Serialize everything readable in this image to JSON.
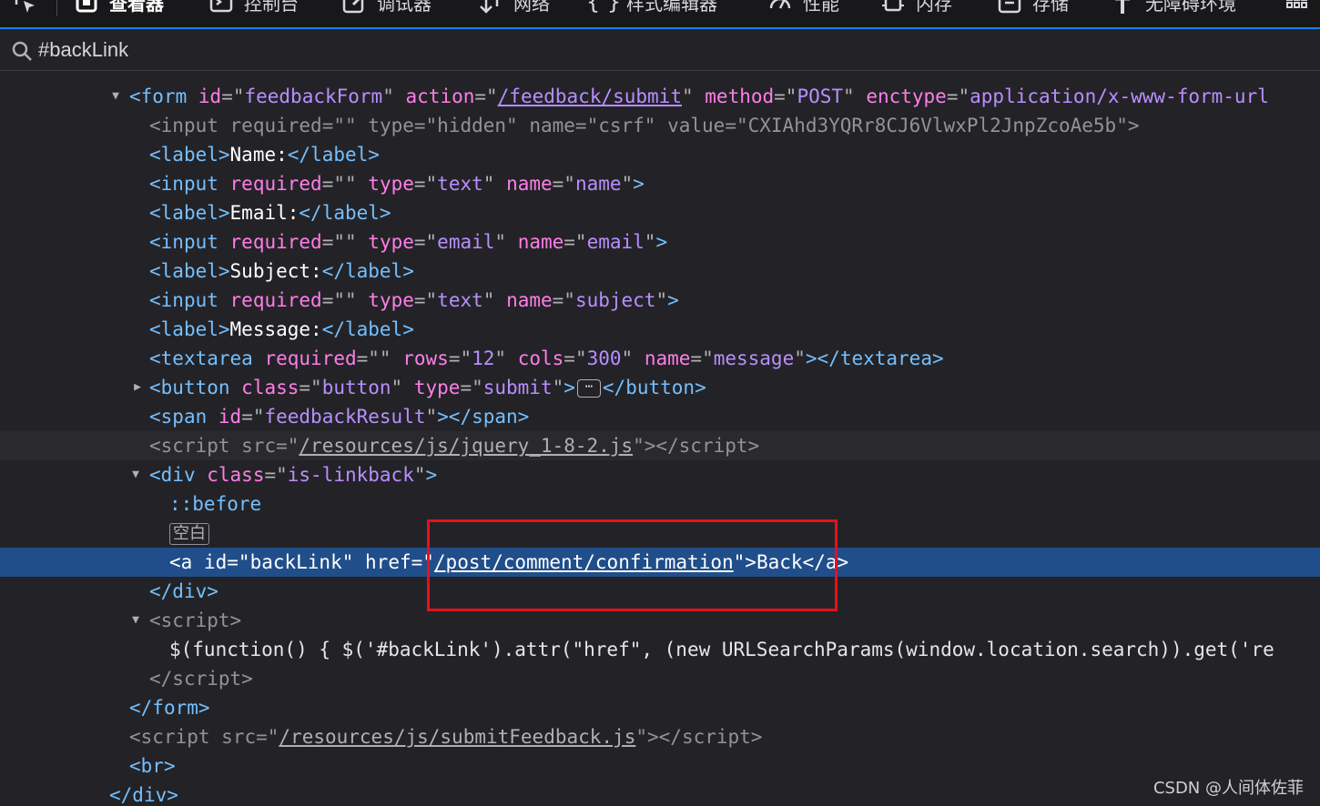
{
  "toolbar": {
    "picker_icon": "element-picker-icon",
    "tabs": [
      {
        "label": "查看器",
        "icon": "inspector-icon"
      },
      {
        "label": "控制台",
        "icon": "console-icon"
      },
      {
        "label": "调试器",
        "icon": "debugger-icon"
      },
      {
        "label": "网络",
        "icon": "network-icon"
      },
      {
        "label": "样式编辑器",
        "icon": "style-editor-icon"
      },
      {
        "label": "性能",
        "icon": "performance-icon"
      },
      {
        "label": "内存",
        "icon": "memory-icon"
      },
      {
        "label": "存储",
        "icon": "storage-icon"
      },
      {
        "label": "无障碍环境",
        "icon": "accessibility-icon"
      }
    ],
    "overflow_icon": "grid-menu-icon"
  },
  "search": {
    "value": "#backLink",
    "icon": "search-icon"
  },
  "tree": {
    "form_open": {
      "tag": "form",
      "id_attr": "id",
      "id_val": "feedbackForm",
      "action_attr": "action",
      "action_val": "/feedback/submit",
      "method_attr": "method",
      "method_val": "POST",
      "enctype_attr": "enctype",
      "enctype_val": "application/x-www-form-url"
    },
    "csrf": {
      "tag": "input",
      "a1": "required",
      "v1": "",
      "a2": "type",
      "v2": "hidden",
      "a3": "name",
      "v3": "csrf",
      "a4": "value",
      "v4": "CXIAhd3YQRr8CJ6VlwxPl2JnpZcoAe5b"
    },
    "label_name": {
      "tag": "label",
      "text": "Name:"
    },
    "input_name": {
      "tag": "input",
      "a1": "required",
      "v1": "",
      "a2": "type",
      "v2": "text",
      "a3": "name",
      "v3": "name"
    },
    "label_email": {
      "tag": "label",
      "text": "Email:"
    },
    "input_email": {
      "tag": "input",
      "a1": "required",
      "v1": "",
      "a2": "type",
      "v2": "email",
      "a3": "name",
      "v3": "email"
    },
    "label_subject": {
      "tag": "label",
      "text": "Subject:"
    },
    "input_subject": {
      "tag": "input",
      "a1": "required",
      "v1": "",
      "a2": "type",
      "v2": "text",
      "a3": "name",
      "v3": "subject"
    },
    "label_message": {
      "tag": "label",
      "text": "Message:"
    },
    "textarea": {
      "tag": "textarea",
      "a1": "required",
      "v1": "",
      "a2": "rows",
      "v2": "12",
      "a3": "cols",
      "v3": "300",
      "a4": "name",
      "v4": "message"
    },
    "button": {
      "tag": "button",
      "a1": "class",
      "v1": "button",
      "a2": "type",
      "v2": "submit"
    },
    "span": {
      "tag": "span",
      "a1": "id",
      "v1": "feedbackResult"
    },
    "script_jquery": {
      "tag": "script",
      "a1": "src",
      "v1": "/resources/js/jquery_1-8-2.js"
    },
    "div_linkback": {
      "tag": "div",
      "a1": "class",
      "v1": "is-linkback"
    },
    "pseudo_before": "::before",
    "whitespace_badge": "空白",
    "anchor": {
      "tag": "a",
      "a1": "id",
      "v1": "backLink",
      "a2": "href",
      "v2": "/post/comment/confirmation",
      "text": "Back"
    },
    "div_close": {
      "tag": "div"
    },
    "script_inline_open": {
      "tag": "script"
    },
    "script_inline_body": "$(function() { $('#backLink').attr(\"href\", (new URLSearchParams(window.location.search)).get('re",
    "script_inline_close": {
      "tag": "script"
    },
    "form_close": {
      "tag": "form"
    },
    "script_submit": {
      "tag": "script",
      "a1": "src",
      "v1": "/resources/js/submitFeedback.js"
    },
    "br": {
      "tag": "br"
    },
    "outer_div_close": {
      "tag": "div"
    }
  },
  "watermark": "CSDN @人间体佐菲",
  "colors": {
    "tag": "#75bfff",
    "attr_name": "#ff7de9",
    "attr_value": "#b98eff",
    "selection": "#204e8a",
    "highlight_box": "#e8101d"
  }
}
